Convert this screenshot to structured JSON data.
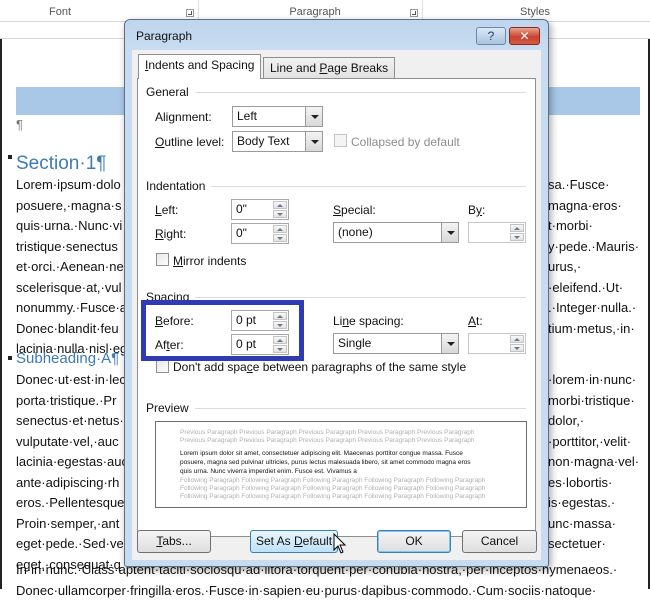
{
  "ribbon": {
    "groups": [
      {
        "label": "Font"
      },
      {
        "label": "Paragraph"
      },
      {
        "label": "Styles"
      }
    ]
  },
  "document": {
    "pilcrow": "¶",
    "section_heading": "Section·1¶",
    "section_lines_left": [
      "Lorem·ipsum·dolo",
      "posuere,·magna·s",
      "quis·urna.·Nunc·vi",
      "tristique·senectus",
      "et·orci.·Aenean·ne",
      "scelerisque·at,·vul",
      "nonummy.·Fusce·a",
      "Donec·blandit·feu",
      "lacinia·nulla·nisl·eg"
    ],
    "section_lines_right": [
      "sa.·Fusce·",
      "magna·eros·",
      "t·morbi·",
      "y·pede.·Mauris·",
      "urus,·",
      "·eleifend.·Ut·",
      ".·Integer·nulla.·",
      "tium·metus,·in·",
      ""
    ],
    "subheading": "Subheading·A¶",
    "sub_lines_left": [
      "Donec·ut·est·in·lec",
      "porta·tristique.·Pr",
      "senectus·et·netus·",
      "vulputate·vel,·auc",
      "lacinia·egestas·auc",
      "ante·adipiscing·rh",
      "eros.·Pellentesque",
      "Proin·semper,·ant",
      "eget·pede.·Sed·ve",
      "eget,·consequat·q"
    ],
    "sub_lines_right": [
      "·lorem·in·nunc·",
      "morbi·tristique·",
      "dolor,·",
      "·porttitor,·velit·",
      "non·magna·vel·",
      "es·lobortis·",
      "is·egestas.·",
      "unc·massa·",
      "sectetuer·",
      ""
    ],
    "bottom_lines": [
      "In·in·nunc.·Class·aptent·taciti·sociosqu·ad·litora·torquent·per·conubia·nostra,·per·inceptos·hymenaeos.·",
      "Donec·ullamcorper·fringilla·eros.·Fusce·in·sapien·eu·purus·dapibus·commodo.·Cum·sociis·natoque·"
    ]
  },
  "dialog": {
    "title": "Paragraph",
    "help_label": "?",
    "close_label": "✕",
    "tabs": [
      {
        "label_pre": "",
        "mnemonic": "I",
        "label_post": "ndents and Spacing",
        "active": true
      },
      {
        "label_pre": "Line and ",
        "mnemonic": "P",
        "label_post": "age Breaks",
        "active": false
      }
    ],
    "general": {
      "title": "General",
      "alignment_label_pre": "Ali",
      "alignment_mnemonic": "g",
      "alignment_label_post": "nment:",
      "alignment_value": "Left",
      "outline_label_pre": "",
      "outline_mnemonic": "O",
      "outline_label_post": "utline level:",
      "outline_value": "Body Text",
      "collapsed_label": "Collapsed by default",
      "collapsed_checked": false
    },
    "indentation": {
      "title": "Indentation",
      "left_mnemonic": "L",
      "left_label_post": "eft:",
      "left_value": "0\"",
      "right_mnemonic": "R",
      "right_label_post": "ight:",
      "right_value": "0\"",
      "special_mnemonic": "S",
      "special_label_post": "pecial:",
      "special_value": "(none)",
      "by_label_pre": "B",
      "by_mnemonic": "y",
      "by_label_post": ":",
      "by_value": "",
      "mirror_mnemonic": "M",
      "mirror_label_post": "irror indents",
      "mirror_checked": false
    },
    "spacing": {
      "title": "Spacing",
      "before_mnemonic": "B",
      "before_label_post": "efore:",
      "before_value": "0 pt",
      "after_label_pre": "Af",
      "after_mnemonic": "t",
      "after_label_post": "er:",
      "after_value": "0 pt",
      "line_spacing_label_pre": "Li",
      "line_spacing_mnemonic": "n",
      "line_spacing_label_post": "e spacing:",
      "line_spacing_value": "Single",
      "at_mnemonic": "A",
      "at_label_post": "t:",
      "at_value": "",
      "dont_add_label_pre": "Don't add spa",
      "dont_add_mnemonic": "c",
      "dont_add_label_post": "e between paragraphs of the same style",
      "dont_add_checked": false
    },
    "preview": {
      "title": "Preview",
      "previous_lines": [
        "Previous Paragraph Previous Paragraph Previous Paragraph Previous Paragraph Previous Paragraph",
        "Previous Paragraph Previous Paragraph Previous Paragraph Previous Paragraph Previous Paragraph"
      ],
      "sample_lines": [
        "Lorem ipsum dolor sit amet, consectetuer adipiscing elit. Maecenas porttitor congue massa. Fusce",
        "posuere, magna sed pulvinar ultricies, purus lectus malesuada libero, sit amet commodo magna eros",
        "quis urna. Nunc viverra imperdiet enim. Fusce est. Vivamus a"
      ],
      "following_lines": [
        "Following Paragraph Following Paragraph Following Paragraph Following Paragraph Following Paragraph",
        "Following Paragraph Following Paragraph Following Paragraph Following Paragraph Following Paragraph",
        "Following Paragraph Following Paragraph Following Paragraph Following Paragraph Following Paragraph"
      ]
    },
    "buttons": {
      "tabs_mnemonic": "T",
      "tabs_label_post": "abs...",
      "set_default_pre": "Set As ",
      "set_default_mnemonic": "D",
      "set_default_post": "efault",
      "ok": "OK",
      "cancel": "Cancel"
    }
  },
  "colors": {
    "highlight_border": "#2e3bb5",
    "heading_blue": "#3d7bb5",
    "header_bar": "#a9c8e8"
  }
}
